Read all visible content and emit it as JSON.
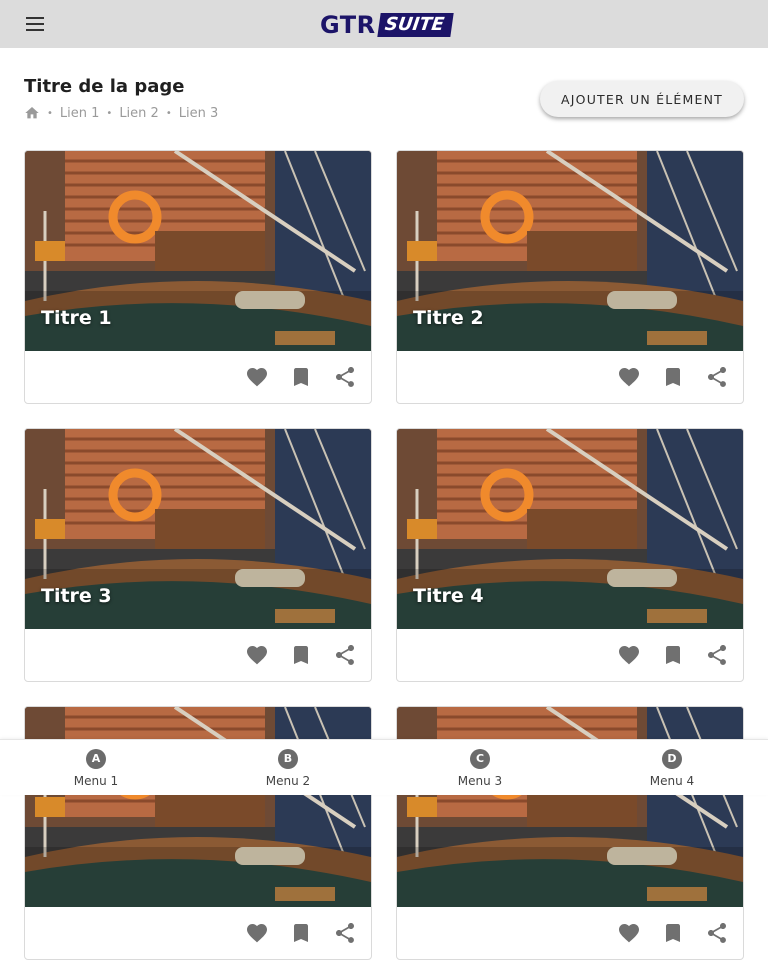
{
  "header": {
    "logo_main": "GTR",
    "logo_badge": "SUITE"
  },
  "page": {
    "title": "Titre de la page",
    "breadcrumb": [
      "Lien 1",
      "Lien 2",
      "Lien 3"
    ],
    "add_button_label": "AJOUTER UN ÉLÉMENT"
  },
  "cards": [
    {
      "title": "Titre 1"
    },
    {
      "title": "Titre 2"
    },
    {
      "title": "Titre 3"
    },
    {
      "title": "Titre 4"
    },
    {
      "title": ""
    },
    {
      "title": ""
    }
  ],
  "card_actions": [
    "heart-icon",
    "bookmark-icon",
    "share-icon"
  ],
  "bottom_nav": [
    {
      "badge": "A",
      "label": "Menu 1"
    },
    {
      "badge": "B",
      "label": "Menu 2"
    },
    {
      "badge": "C",
      "label": "Menu 3"
    },
    {
      "badge": "D",
      "label": "Menu 4"
    }
  ],
  "colors": {
    "brand": "#1c1468",
    "topbar": "#dcdcdc",
    "icon": "#707070"
  }
}
